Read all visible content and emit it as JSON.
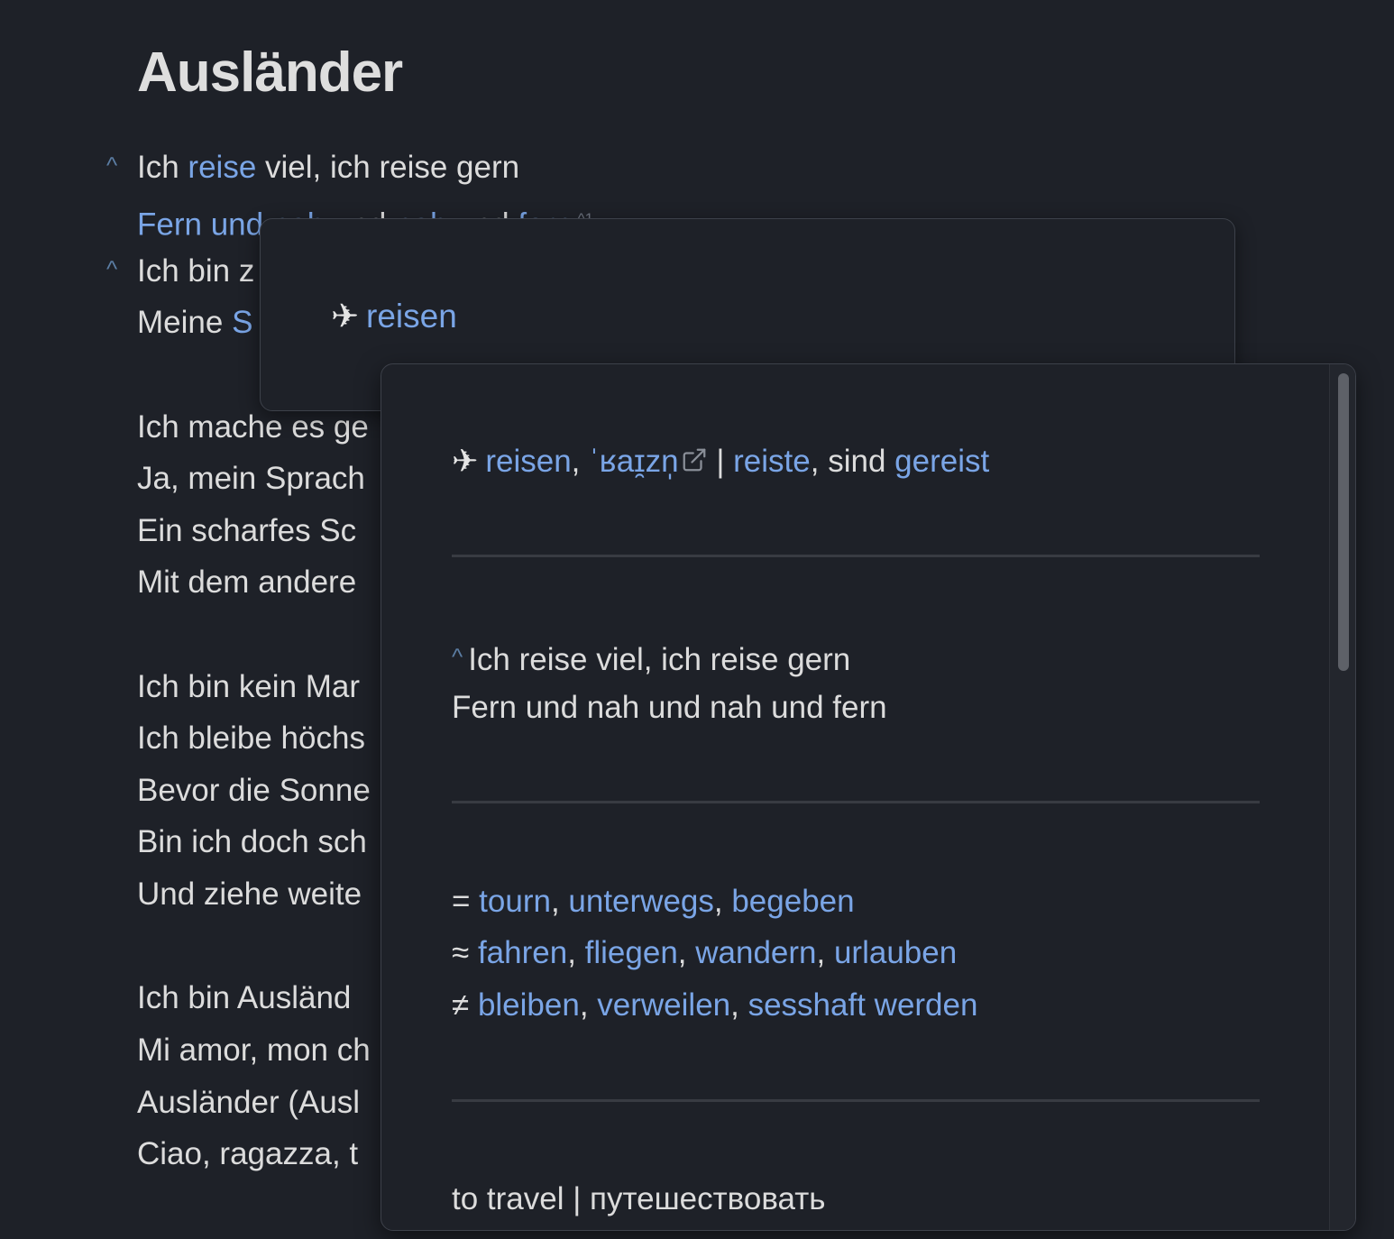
{
  "page": {
    "title": "Ausländer"
  },
  "lyrics": {
    "caret": "^",
    "line1": {
      "a": "Ich ",
      "b": "reise",
      "c": " viel, ich reise gern"
    },
    "line2": {
      "a": "Fern und nah",
      "b": " und ",
      "c": "nah",
      "d": " und ",
      "e": "fern",
      "footnote": "^1"
    },
    "line3": "Ich bin z",
    "line4": {
      "a": "Meine ",
      "b": "S"
    },
    "line5": "Ich mache es ge",
    "line6": "Ja, mein Sprach",
    "line7": "Ein scharfes Sc",
    "line8": "Mit dem andere",
    "line9": "Ich bin kein Mar",
    "line10": "Ich bleibe höchs",
    "line11": "Bevor die Sonne",
    "line12": "Bin ich doch sch",
    "line13": "Und ziehe weite",
    "line14": "Ich bin Ausländ",
    "line15": "Mi amor, mon ch",
    "line16": "Ausländer (Ausl",
    "line17": "Ciao, ragazza, t"
  },
  "preview_small": {
    "plane": "✈",
    "word": "reisen"
  },
  "preview_large": {
    "plane": "✈",
    "infinitive": "reisen",
    "sep1": ", ",
    "ipa": "ˈʁaɪ̯zn̩",
    "bar": " | ",
    "preterite": "reiste",
    "sep2": ", sind ",
    "participle": "gereist",
    "caret": "^",
    "quote_line1": "Ich reise viel, ich reise gern",
    "quote_line2": "Fern und nah und nah und fern",
    "synonyms": {
      "symbol": "= ",
      "items": [
        "tourn",
        "unterwegs",
        "begeben"
      ]
    },
    "similar": {
      "symbol": "≈ ",
      "items": [
        "fahren",
        "fliegen",
        "wandern",
        "urlauben"
      ]
    },
    "antonyms": {
      "symbol": "≠ ",
      "items": [
        "bleiben",
        "verweilen",
        "sesshaft werden"
      ]
    },
    "comma": ", ",
    "translation": "to travel | путешествовать"
  },
  "colors": {
    "background": "#1e2128",
    "link": "#7aa5e6",
    "text": "#dcdcdc",
    "divider": "#383b42"
  }
}
